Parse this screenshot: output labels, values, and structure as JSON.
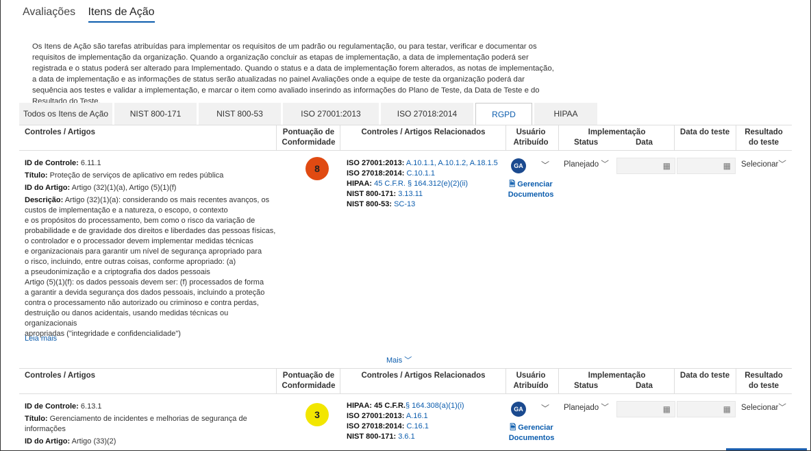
{
  "nav": {
    "tab1": "Avaliações",
    "tab2": "Itens de Ação"
  },
  "intro": "Os Itens de Ação são tarefas atribuídas para implementar os requisitos de um padrão ou regulamentação, ou para testar, verificar e documentar os requisitos de implementação da organização. Quando a organização concluir as etapas de implementação, a data de implementação poderá ser registrada e o status poderá ser alterado para Implementado. Quando o status e a data de implementação forem alterados, as notas de implementação, a data de implementação e as informações de status serão atualizadas no painel Avaliações onde a equipe de teste da organização poderá dar sequência aos testes e validar a implementação, e marcar o item como avaliado inserindo as informações do Plano de Teste, da Data de Teste e do Resultado do Teste.",
  "tabs": [
    "Todos os Itens de Ação",
    "NIST 800-171",
    "NIST 800-53",
    "ISO 27001:2013",
    "ISO 27018:2014",
    "RGPD",
    "HIPAA"
  ],
  "headers": {
    "controls": "Controles / Artigos",
    "score1": "Pontuação de",
    "score2": "Conformidade",
    "related": "Controles / Artigos Relacionados",
    "user1": "Usuário",
    "user2": "Atribuído",
    "impl": "Implementação",
    "status": "Status",
    "data": "Data",
    "testdate": "Data do teste",
    "result1": "Resultado",
    "result2": "do teste"
  },
  "row1": {
    "control_id_label": "ID de Controle:",
    "control_id": "6.11.1",
    "title_label": "Título:",
    "title": "Proteção de serviços de aplicativo em redes pública",
    "article_label": "ID do Artigo:",
    "article": "Artigo (32)(1)(a), Artigo (5)(1)(f)",
    "desc_label": "Descrição:",
    "desc_lines": [
      " Artigo (32)(1)(a): considerando os mais recentes avanços, os",
      "custos de implementação e a natureza, o escopo, o contexto",
      "e os propósitos do processamento, bem como o risco da variação de",
      "probabilidade e de gravidade dos direitos e liberdades das pessoas físicas,",
      "o controlador e o processador devem implementar medidas técnicas",
      "e organizacionais para garantir um nível de segurança apropriado para",
      "o risco, incluindo, entre outras coisas, conforme apropriado: (a)",
      "a pseudonimização e a criptografia dos dados pessoais",
      "Artigo (5)(1)(f): os dados pessoais devem ser: (f) processados de forma",
      "a garantir a devida segurança dos dados pessoais, incluindo a proteção",
      "contra o processamento não autorizado ou criminoso e contra perdas,",
      "destruição ou danos acidentais, usando medidas técnicas ou organizacionais",
      "apropriadas (\"integridade e confidencialidade\")"
    ],
    "read_more": "Leia mais",
    "score": "8",
    "related": [
      {
        "label": "ISO 27001:2013:",
        "links": "A.10.1.1, A.10.1.2, A.18.1.5"
      },
      {
        "label": "ISO 27018:2014:",
        "links": "C.10.1.1"
      },
      {
        "label": "HIPAA:",
        "links": "45 C.F.R. § 164.312(e)(2)(ii)"
      },
      {
        "label": "NIST 800-171:",
        "links": "3.13.11"
      },
      {
        "label": "NIST 800-53:",
        "links": "SC-13"
      }
    ],
    "avatar": "GA",
    "manage1": "Gerenciar",
    "manage2": "Documentos",
    "status": "Planejado",
    "result": "Selecionar"
  },
  "more": "Mais",
  "row2": {
    "control_id_label": "ID de Controle:",
    "control_id": "6.13.1",
    "title_label": "Título:",
    "title_line1": "Gerenciamento de incidentes e melhorias de segurança de",
    "title_line2": "informações",
    "article_label": "ID do Artigo:",
    "article": "Artigo (33)(2)",
    "score": "3",
    "related": [
      {
        "label": "HIPAA: 45 C.F.R.",
        "links": "§ 164.308(a)(1)(i)"
      },
      {
        "label": "ISO 27001:2013:",
        "links": "A.16.1"
      },
      {
        "label": "ISO 27018:2014:",
        "links": "C.16.1"
      },
      {
        "label": "NIST 800-171:",
        "links": "3.6.1"
      }
    ],
    "avatar": "GA",
    "manage1": "Gerenciar",
    "manage2": "Documentos",
    "status": "Planejado",
    "result": "Selecionar"
  },
  "colors": {
    "accent": "#0b5cad",
    "score_high": "#e04a12",
    "score_low": "#f2e600"
  }
}
